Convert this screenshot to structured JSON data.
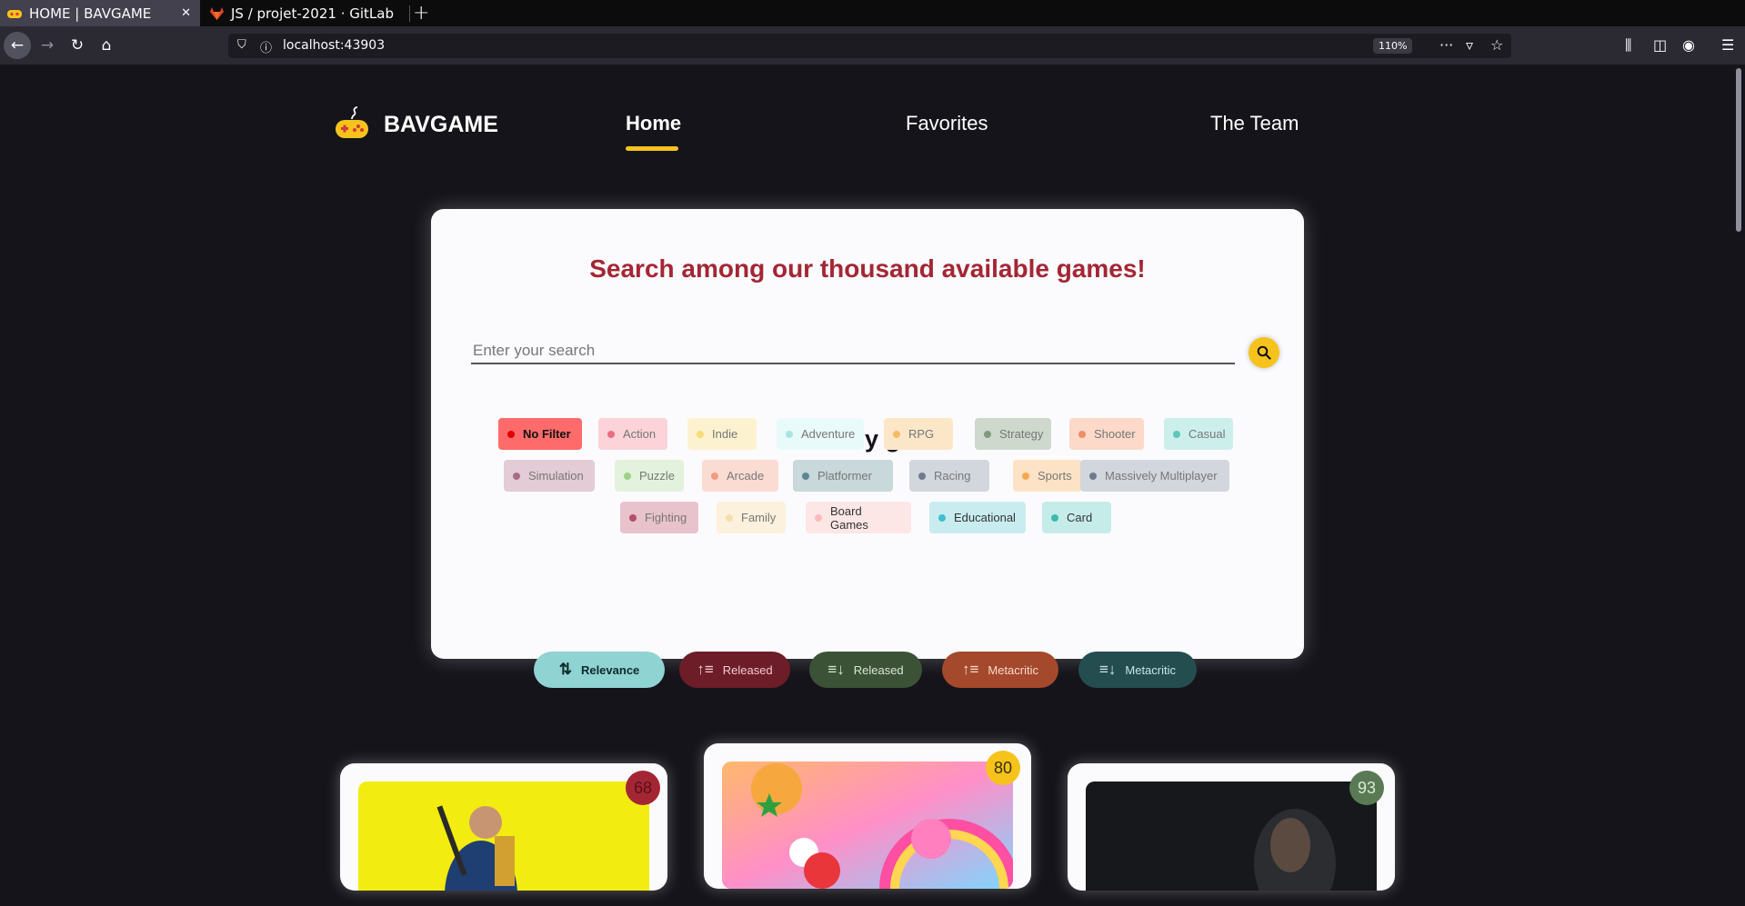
{
  "browser": {
    "tabs": [
      {
        "title": "HOME | BAVGAME",
        "active": true
      },
      {
        "title": "JS / projet-2021 · GitLab",
        "active": false
      }
    ],
    "url": "localhost:43903",
    "zoom": "110%"
  },
  "header": {
    "brand": "BAVGAME",
    "nav": [
      {
        "label": "Home",
        "active": true
      },
      {
        "label": "Favorites",
        "active": false
      },
      {
        "label": "The Team",
        "active": false
      }
    ]
  },
  "search": {
    "title": "Search among our thousand available games!",
    "placeholder": "Enter your search",
    "filter_title": "Filter by genre"
  },
  "genres": [
    {
      "label": "No Filter",
      "bg": "#ff6b6b",
      "dot": "#e00000",
      "color": "#111111",
      "bold": true
    },
    {
      "label": "Action",
      "bg": "#fbd3d8",
      "dot": "#f06b80",
      "color": "#777777"
    },
    {
      "label": "Indie",
      "bg": "#fdf2cf",
      "dot": "#f8dc78",
      "color": "#777777"
    },
    {
      "label": "Adventure",
      "bg": "#e8fafa",
      "dot": "#a9e5e1",
      "color": "#777777"
    },
    {
      "label": "RPG",
      "bg": "#fbe7c8",
      "dot": "#f6bb67",
      "color": "#777777"
    },
    {
      "label": "Strategy",
      "bg": "#ced8cd",
      "dot": "#7f9a7d",
      "color": "#777777"
    },
    {
      "label": "Shooter",
      "bg": "#fcd9c9",
      "dot": "#ef8d69",
      "color": "#777777"
    },
    {
      "label": "Casual",
      "bg": "#cdefeb",
      "dot": "#5fc6bb",
      "color": "#777777"
    },
    {
      "label": "Simulation",
      "bg": "#e3ccd5",
      "dot": "#a56e85",
      "color": "#777777"
    },
    {
      "label": "Puzzle",
      "bg": "#e3f2dc",
      "dot": "#9ad288",
      "color": "#777777"
    },
    {
      "label": "Arcade",
      "bg": "#fbdcd3",
      "dot": "#f19c83",
      "color": "#777777"
    },
    {
      "label": "Platformer",
      "bg": "#c8d8db",
      "dot": "#5c8790",
      "color": "#777777"
    },
    {
      "label": "Racing",
      "bg": "#d2d6dd",
      "dot": "#6f7a8e",
      "color": "#777777"
    },
    {
      "label": "Sports",
      "bg": "#fde3c5",
      "dot": "#f6a84e",
      "color": "#777777"
    },
    {
      "label": "Massively Multiplayer",
      "bg": "#d2d6dd",
      "dot": "#6f7a8e",
      "color": "#777777"
    },
    {
      "label": "Fighting",
      "bg": "#e8c3cb",
      "dot": "#b34f66",
      "color": "#777777"
    },
    {
      "label": "Family",
      "bg": "#fbf1dc",
      "dot": "#f3e0ae",
      "color": "#777777"
    },
    {
      "label": "Board Games",
      "bg": "#fde6e6",
      "dot": "#f6bcbc",
      "color": "#333333"
    },
    {
      "label": "Educational",
      "bg": "#c9ecf0",
      "dot": "#3fbfcc",
      "color": "#333333"
    },
    {
      "label": "Card",
      "bg": "#c6ecea",
      "dot": "#3db9b0",
      "color": "#333333"
    }
  ],
  "sort": [
    {
      "label": "Relevance",
      "icon": "sort-relevance-icon",
      "bg": "#8fd3d3",
      "color": "#0f2a2a"
    },
    {
      "label": "Released",
      "icon": "sort-asc-icon",
      "bg": "#6d1d28",
      "color": "#f2c9ce"
    },
    {
      "label": "Released",
      "icon": "sort-desc-icon",
      "bg": "#3c5237",
      "color": "#d9e6d6"
    },
    {
      "label": "Metacritic",
      "icon": "sort-asc-icon",
      "bg": "#a4492c",
      "color": "#f8d9cd"
    },
    {
      "label": "Metacritic",
      "icon": "sort-desc-icon",
      "bg": "#244d50",
      "color": "#c9e4e6"
    }
  ],
  "games": [
    {
      "score": "68",
      "score_bg": "#a42634",
      "score_color": "#5a1019",
      "image": "cyberpunk-cover"
    },
    {
      "score": "80",
      "score_bg": "#f6c31c",
      "score_color": "#3b2f00",
      "image": "fall-guys-cover"
    },
    {
      "score": "93",
      "score_bg": "#5a7a55",
      "score_color": "#d8ecd3",
      "image": "last-of-us-cover"
    }
  ]
}
